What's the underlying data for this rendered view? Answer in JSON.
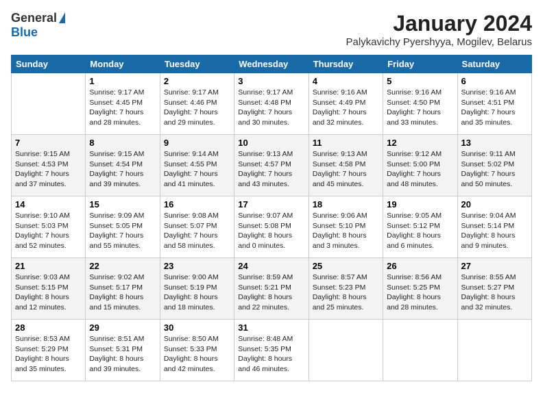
{
  "header": {
    "logo_general": "General",
    "logo_blue": "Blue",
    "month_title": "January 2024",
    "location": "Palykavichy Pyershyya, Mogilev, Belarus"
  },
  "weekdays": [
    "Sunday",
    "Monday",
    "Tuesday",
    "Wednesday",
    "Thursday",
    "Friday",
    "Saturday"
  ],
  "weeks": [
    [
      {
        "day": "",
        "info": ""
      },
      {
        "day": "1",
        "info": "Sunrise: 9:17 AM\nSunset: 4:45 PM\nDaylight: 7 hours\nand 28 minutes."
      },
      {
        "day": "2",
        "info": "Sunrise: 9:17 AM\nSunset: 4:46 PM\nDaylight: 7 hours\nand 29 minutes."
      },
      {
        "day": "3",
        "info": "Sunrise: 9:17 AM\nSunset: 4:48 PM\nDaylight: 7 hours\nand 30 minutes."
      },
      {
        "day": "4",
        "info": "Sunrise: 9:16 AM\nSunset: 4:49 PM\nDaylight: 7 hours\nand 32 minutes."
      },
      {
        "day": "5",
        "info": "Sunrise: 9:16 AM\nSunset: 4:50 PM\nDaylight: 7 hours\nand 33 minutes."
      },
      {
        "day": "6",
        "info": "Sunrise: 9:16 AM\nSunset: 4:51 PM\nDaylight: 7 hours\nand 35 minutes."
      }
    ],
    [
      {
        "day": "7",
        "info": "Sunrise: 9:15 AM\nSunset: 4:53 PM\nDaylight: 7 hours\nand 37 minutes."
      },
      {
        "day": "8",
        "info": "Sunrise: 9:15 AM\nSunset: 4:54 PM\nDaylight: 7 hours\nand 39 minutes."
      },
      {
        "day": "9",
        "info": "Sunrise: 9:14 AM\nSunset: 4:55 PM\nDaylight: 7 hours\nand 41 minutes."
      },
      {
        "day": "10",
        "info": "Sunrise: 9:13 AM\nSunset: 4:57 PM\nDaylight: 7 hours\nand 43 minutes."
      },
      {
        "day": "11",
        "info": "Sunrise: 9:13 AM\nSunset: 4:58 PM\nDaylight: 7 hours\nand 45 minutes."
      },
      {
        "day": "12",
        "info": "Sunrise: 9:12 AM\nSunset: 5:00 PM\nDaylight: 7 hours\nand 48 minutes."
      },
      {
        "day": "13",
        "info": "Sunrise: 9:11 AM\nSunset: 5:02 PM\nDaylight: 7 hours\nand 50 minutes."
      }
    ],
    [
      {
        "day": "14",
        "info": "Sunrise: 9:10 AM\nSunset: 5:03 PM\nDaylight: 7 hours\nand 52 minutes."
      },
      {
        "day": "15",
        "info": "Sunrise: 9:09 AM\nSunset: 5:05 PM\nDaylight: 7 hours\nand 55 minutes."
      },
      {
        "day": "16",
        "info": "Sunrise: 9:08 AM\nSunset: 5:07 PM\nDaylight: 7 hours\nand 58 minutes."
      },
      {
        "day": "17",
        "info": "Sunrise: 9:07 AM\nSunset: 5:08 PM\nDaylight: 8 hours\nand 0 minutes."
      },
      {
        "day": "18",
        "info": "Sunrise: 9:06 AM\nSunset: 5:10 PM\nDaylight: 8 hours\nand 3 minutes."
      },
      {
        "day": "19",
        "info": "Sunrise: 9:05 AM\nSunset: 5:12 PM\nDaylight: 8 hours\nand 6 minutes."
      },
      {
        "day": "20",
        "info": "Sunrise: 9:04 AM\nSunset: 5:14 PM\nDaylight: 8 hours\nand 9 minutes."
      }
    ],
    [
      {
        "day": "21",
        "info": "Sunrise: 9:03 AM\nSunset: 5:15 PM\nDaylight: 8 hours\nand 12 minutes."
      },
      {
        "day": "22",
        "info": "Sunrise: 9:02 AM\nSunset: 5:17 PM\nDaylight: 8 hours\nand 15 minutes."
      },
      {
        "day": "23",
        "info": "Sunrise: 9:00 AM\nSunset: 5:19 PM\nDaylight: 8 hours\nand 18 minutes."
      },
      {
        "day": "24",
        "info": "Sunrise: 8:59 AM\nSunset: 5:21 PM\nDaylight: 8 hours\nand 22 minutes."
      },
      {
        "day": "25",
        "info": "Sunrise: 8:57 AM\nSunset: 5:23 PM\nDaylight: 8 hours\nand 25 minutes."
      },
      {
        "day": "26",
        "info": "Sunrise: 8:56 AM\nSunset: 5:25 PM\nDaylight: 8 hours\nand 28 minutes."
      },
      {
        "day": "27",
        "info": "Sunrise: 8:55 AM\nSunset: 5:27 PM\nDaylight: 8 hours\nand 32 minutes."
      }
    ],
    [
      {
        "day": "28",
        "info": "Sunrise: 8:53 AM\nSunset: 5:29 PM\nDaylight: 8 hours\nand 35 minutes."
      },
      {
        "day": "29",
        "info": "Sunrise: 8:51 AM\nSunset: 5:31 PM\nDaylight: 8 hours\nand 39 minutes."
      },
      {
        "day": "30",
        "info": "Sunrise: 8:50 AM\nSunset: 5:33 PM\nDaylight: 8 hours\nand 42 minutes."
      },
      {
        "day": "31",
        "info": "Sunrise: 8:48 AM\nSunset: 5:35 PM\nDaylight: 8 hours\nand 46 minutes."
      },
      {
        "day": "",
        "info": ""
      },
      {
        "day": "",
        "info": ""
      },
      {
        "day": "",
        "info": ""
      }
    ]
  ]
}
